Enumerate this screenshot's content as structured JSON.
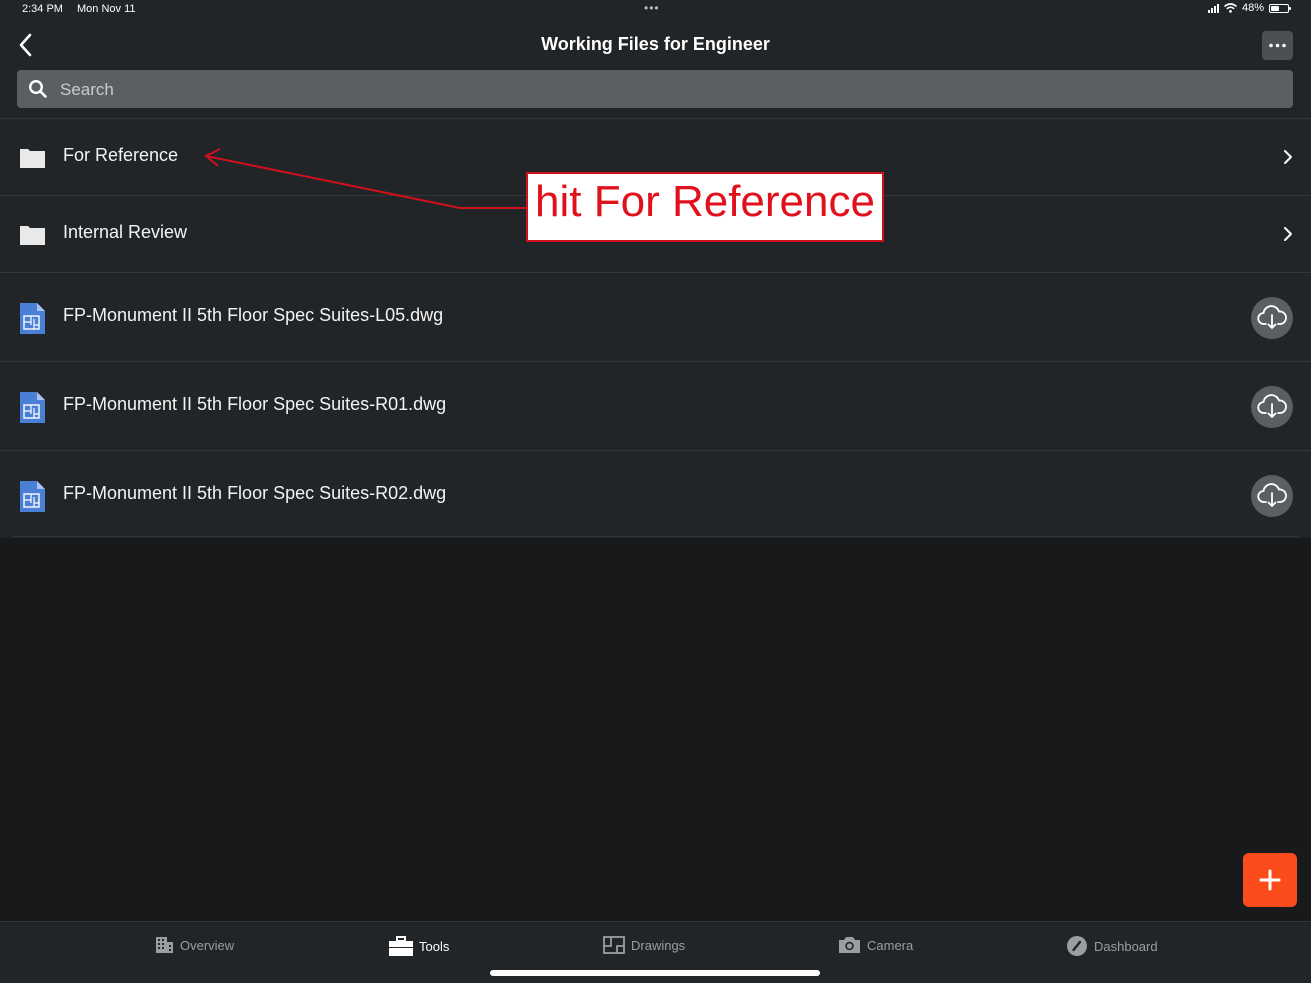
{
  "status_bar": {
    "time": "2:34 PM",
    "date": "Mon Nov 11",
    "dots": "•••",
    "battery": "48%",
    "battery_level": 0.48
  },
  "header": {
    "title": "Working Files for Engineer"
  },
  "search": {
    "placeholder": "Search"
  },
  "folders": [
    {
      "label": "For Reference",
      "icon": "folder-icon"
    },
    {
      "label": "Internal Review",
      "icon": "folder-icon"
    }
  ],
  "files": [
    {
      "label": "FP-Monument II 5th Floor Spec Suites-L05.dwg",
      "icon": "dwg-file-icon"
    },
    {
      "label": "FP-Monument II 5th Floor Spec Suites-R01.dwg",
      "icon": "dwg-file-icon"
    },
    {
      "label": "FP-Monument II 5th Floor Spec Suites-R02.dwg",
      "icon": "dwg-file-icon"
    }
  ],
  "annotation": {
    "text": "hit For Reference",
    "color": "#e0101c"
  },
  "tabs": [
    {
      "label": "Overview",
      "icon": "building-icon",
      "active": false
    },
    {
      "label": "Tools",
      "icon": "toolbox-icon",
      "active": true
    },
    {
      "label": "Drawings",
      "icon": "drawings-icon",
      "active": false
    },
    {
      "label": "Camera",
      "icon": "camera-icon",
      "active": false
    },
    {
      "label": "Dashboard",
      "icon": "gauge-icon",
      "active": false
    }
  ],
  "colors": {
    "accent": "#fc4c1d",
    "background": "#17191b",
    "panel": "#222528",
    "file_icon": "#4a7fd6"
  }
}
